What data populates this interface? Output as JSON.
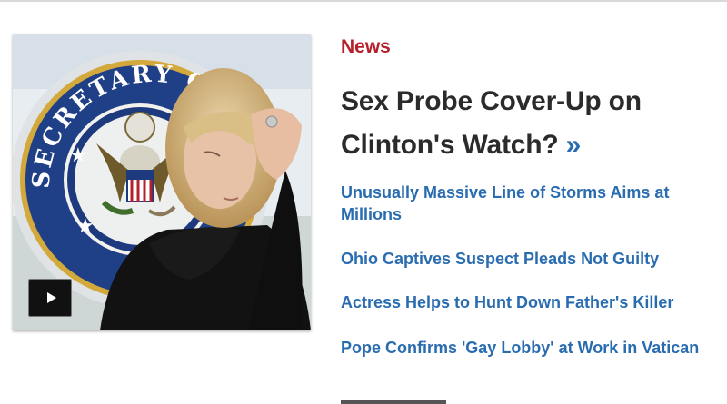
{
  "section_label": "News",
  "headline": {
    "text": "Sex Probe Cover-Up on Clinton's Watch?",
    "more_glyph": "»"
  },
  "stories": [
    "Unusually Massive Line of Storms Aims at Millions",
    "Ohio Captives Suspect Pleads Not Guilty",
    "Actress Helps to Hunt Down Father's Killer",
    "Pope Confirms 'Gay Lobby' at Work in Vatican"
  ],
  "image": {
    "seal_text": "SECRETARY OF STATE",
    "play_icon": "play-icon"
  },
  "colors": {
    "section": "#b5202b",
    "headline": "#2b2b2b",
    "link": "#2a6cb0"
  }
}
